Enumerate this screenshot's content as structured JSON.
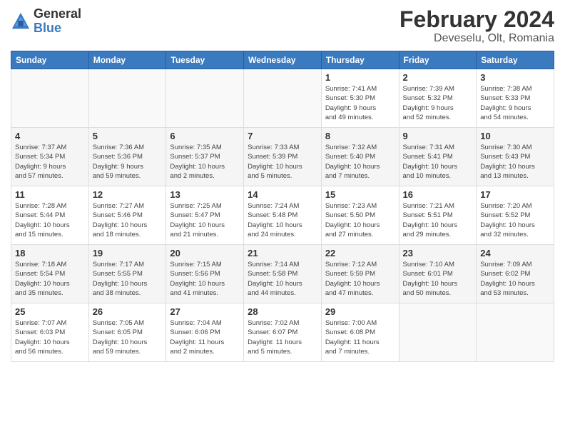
{
  "logo": {
    "general": "General",
    "blue": "Blue"
  },
  "header": {
    "month_year": "February 2024",
    "location": "Deveselu, Olt, Romania"
  },
  "weekdays": [
    "Sunday",
    "Monday",
    "Tuesday",
    "Wednesday",
    "Thursday",
    "Friday",
    "Saturday"
  ],
  "weeks": [
    [
      {
        "day": "",
        "info": ""
      },
      {
        "day": "",
        "info": ""
      },
      {
        "day": "",
        "info": ""
      },
      {
        "day": "",
        "info": ""
      },
      {
        "day": "1",
        "info": "Sunrise: 7:41 AM\nSunset: 5:30 PM\nDaylight: 9 hours\nand 49 minutes."
      },
      {
        "day": "2",
        "info": "Sunrise: 7:39 AM\nSunset: 5:32 PM\nDaylight: 9 hours\nand 52 minutes."
      },
      {
        "day": "3",
        "info": "Sunrise: 7:38 AM\nSunset: 5:33 PM\nDaylight: 9 hours\nand 54 minutes."
      }
    ],
    [
      {
        "day": "4",
        "info": "Sunrise: 7:37 AM\nSunset: 5:34 PM\nDaylight: 9 hours\nand 57 minutes."
      },
      {
        "day": "5",
        "info": "Sunrise: 7:36 AM\nSunset: 5:36 PM\nDaylight: 9 hours\nand 59 minutes."
      },
      {
        "day": "6",
        "info": "Sunrise: 7:35 AM\nSunset: 5:37 PM\nDaylight: 10 hours\nand 2 minutes."
      },
      {
        "day": "7",
        "info": "Sunrise: 7:33 AM\nSunset: 5:39 PM\nDaylight: 10 hours\nand 5 minutes."
      },
      {
        "day": "8",
        "info": "Sunrise: 7:32 AM\nSunset: 5:40 PM\nDaylight: 10 hours\nand 7 minutes."
      },
      {
        "day": "9",
        "info": "Sunrise: 7:31 AM\nSunset: 5:41 PM\nDaylight: 10 hours\nand 10 minutes."
      },
      {
        "day": "10",
        "info": "Sunrise: 7:30 AM\nSunset: 5:43 PM\nDaylight: 10 hours\nand 13 minutes."
      }
    ],
    [
      {
        "day": "11",
        "info": "Sunrise: 7:28 AM\nSunset: 5:44 PM\nDaylight: 10 hours\nand 15 minutes."
      },
      {
        "day": "12",
        "info": "Sunrise: 7:27 AM\nSunset: 5:46 PM\nDaylight: 10 hours\nand 18 minutes."
      },
      {
        "day": "13",
        "info": "Sunrise: 7:25 AM\nSunset: 5:47 PM\nDaylight: 10 hours\nand 21 minutes."
      },
      {
        "day": "14",
        "info": "Sunrise: 7:24 AM\nSunset: 5:48 PM\nDaylight: 10 hours\nand 24 minutes."
      },
      {
        "day": "15",
        "info": "Sunrise: 7:23 AM\nSunset: 5:50 PM\nDaylight: 10 hours\nand 27 minutes."
      },
      {
        "day": "16",
        "info": "Sunrise: 7:21 AM\nSunset: 5:51 PM\nDaylight: 10 hours\nand 29 minutes."
      },
      {
        "day": "17",
        "info": "Sunrise: 7:20 AM\nSunset: 5:52 PM\nDaylight: 10 hours\nand 32 minutes."
      }
    ],
    [
      {
        "day": "18",
        "info": "Sunrise: 7:18 AM\nSunset: 5:54 PM\nDaylight: 10 hours\nand 35 minutes."
      },
      {
        "day": "19",
        "info": "Sunrise: 7:17 AM\nSunset: 5:55 PM\nDaylight: 10 hours\nand 38 minutes."
      },
      {
        "day": "20",
        "info": "Sunrise: 7:15 AM\nSunset: 5:56 PM\nDaylight: 10 hours\nand 41 minutes."
      },
      {
        "day": "21",
        "info": "Sunrise: 7:14 AM\nSunset: 5:58 PM\nDaylight: 10 hours\nand 44 minutes."
      },
      {
        "day": "22",
        "info": "Sunrise: 7:12 AM\nSunset: 5:59 PM\nDaylight: 10 hours\nand 47 minutes."
      },
      {
        "day": "23",
        "info": "Sunrise: 7:10 AM\nSunset: 6:01 PM\nDaylight: 10 hours\nand 50 minutes."
      },
      {
        "day": "24",
        "info": "Sunrise: 7:09 AM\nSunset: 6:02 PM\nDaylight: 10 hours\nand 53 minutes."
      }
    ],
    [
      {
        "day": "25",
        "info": "Sunrise: 7:07 AM\nSunset: 6:03 PM\nDaylight: 10 hours\nand 56 minutes."
      },
      {
        "day": "26",
        "info": "Sunrise: 7:05 AM\nSunset: 6:05 PM\nDaylight: 10 hours\nand 59 minutes."
      },
      {
        "day": "27",
        "info": "Sunrise: 7:04 AM\nSunset: 6:06 PM\nDaylight: 11 hours\nand 2 minutes."
      },
      {
        "day": "28",
        "info": "Sunrise: 7:02 AM\nSunset: 6:07 PM\nDaylight: 11 hours\nand 5 minutes."
      },
      {
        "day": "29",
        "info": "Sunrise: 7:00 AM\nSunset: 6:08 PM\nDaylight: 11 hours\nand 7 minutes."
      },
      {
        "day": "",
        "info": ""
      },
      {
        "day": "",
        "info": ""
      }
    ]
  ]
}
